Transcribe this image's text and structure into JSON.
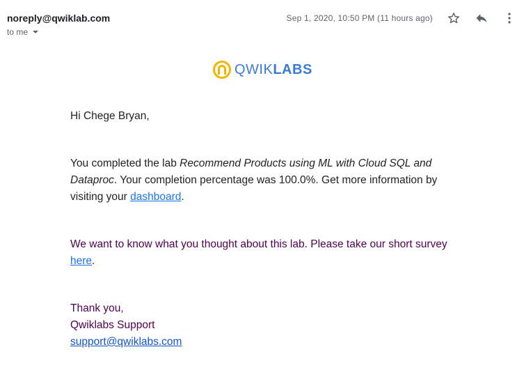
{
  "header": {
    "sender": "noreply@qwiklab.com",
    "to_label": "to me",
    "timestamp": "Sep 1, 2020, 10:50 PM (11 hours ago)"
  },
  "icons": {
    "star": "star-icon",
    "reply": "reply-icon",
    "more": "more-vert-icon",
    "logo": "qwiklabs-logo-icon"
  },
  "logo": {
    "text_a": "QWIK",
    "text_b": "LABS"
  },
  "email": {
    "greeting": "Hi Chege Bryan,",
    "para1_prefix": "You completed the lab ",
    "lab_name": "Recommend Products using ML with Cloud SQL and Dataproc",
    "para1_middle": ". Your completion percentage was 100.0%. Get more information by visiting your ",
    "dashboard_link": "dashboard",
    "para1_end": ".",
    "para2_text": "We want to know what you thought about this lab. Please take our short survey ",
    "survey_link": "here",
    "para2_end": ".",
    "thanks": "Thank you,",
    "signature": "Qwiklabs Support",
    "support_email": "support@qwiklabs.com"
  },
  "colors": {
    "accent_blue": "#1a73e8",
    "logo_yellow": "#f4b400",
    "logo_blue": "#3a7bd5",
    "quoted_purple": "#500050"
  }
}
